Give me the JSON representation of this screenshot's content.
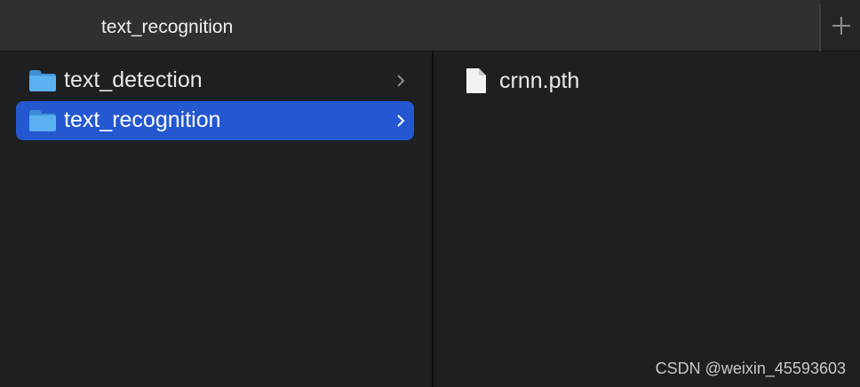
{
  "tab": {
    "title": "text_recognition",
    "new_tab_icon": "plus-icon"
  },
  "column1": {
    "items": [
      {
        "label": "text_detection",
        "icon": "folder-icon",
        "selected": false
      },
      {
        "label": "text_recognition",
        "icon": "folder-icon",
        "selected": true
      }
    ]
  },
  "column2": {
    "items": [
      {
        "label": "crnn.pth",
        "icon": "document-icon"
      }
    ]
  },
  "watermark": "CSDN @weixin_45593603",
  "colors": {
    "selection": "#2458d1",
    "background": "#1e1f21",
    "folder": "#5ab0f0"
  }
}
